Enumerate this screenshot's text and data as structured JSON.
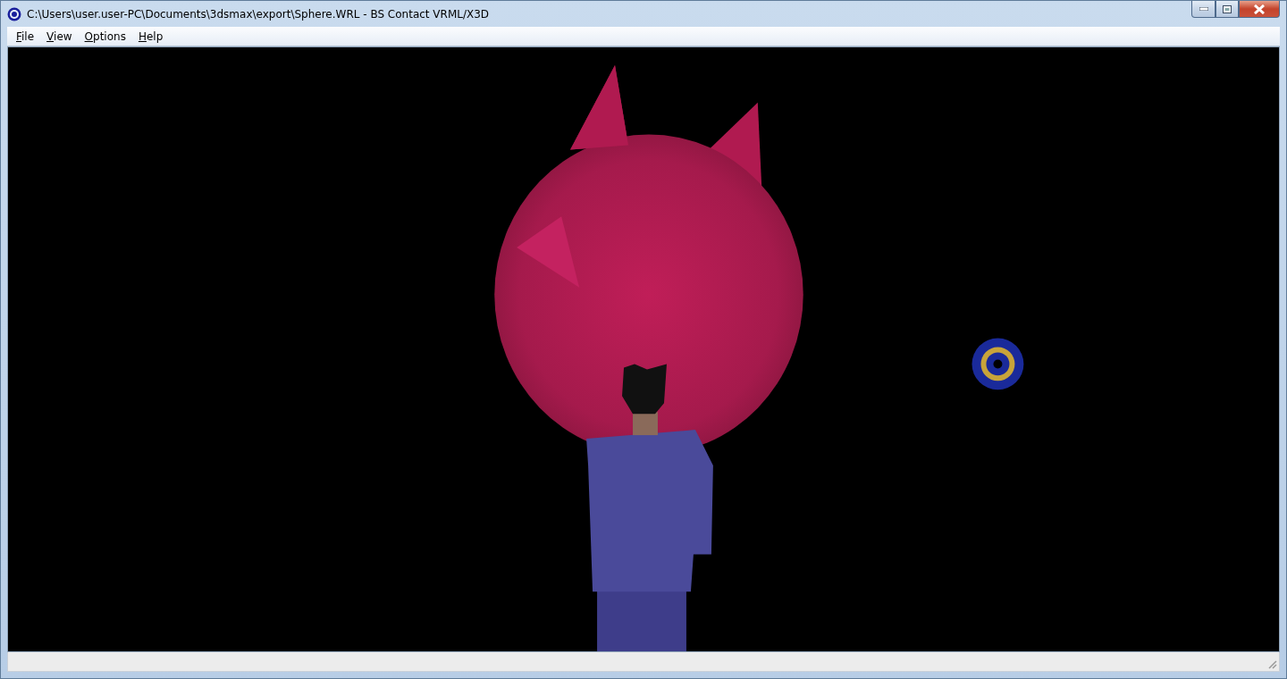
{
  "window": {
    "title": "C:\\Users\\user.user-PC\\Documents\\3dsmax\\export\\Sphere.WRL - BS Contact VRML/X3D"
  },
  "menu": [
    {
      "label": "File"
    },
    {
      "label": "View"
    },
    {
      "label": "Options"
    },
    {
      "label": "Help"
    }
  ]
}
